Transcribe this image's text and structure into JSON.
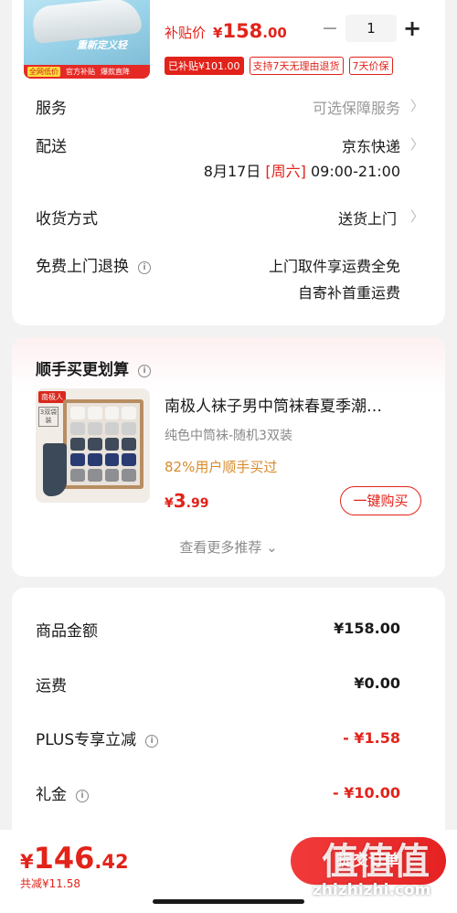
{
  "product": {
    "thumb_slogan": "重新定义轻",
    "thumb_badges": [
      "全网低价",
      "官方补贴",
      "爆款直降"
    ],
    "price_label": "补贴价",
    "currency": "¥",
    "price_main": "158",
    "price_decimal": ".00",
    "quantity": "1",
    "minus_symbol": "−",
    "plus_symbol": "+",
    "tags": [
      "已补贴¥101.00",
      "支持7天无理由退货",
      "7天价保"
    ]
  },
  "service": {
    "label": "服务",
    "value": "可选保障服务"
  },
  "delivery": {
    "label": "配送",
    "carrier": "京东快递",
    "date": "8月17日",
    "weekday": "[周六]",
    "time": "09:00-21:00"
  },
  "receive": {
    "label": "收货方式",
    "value": "送货上门"
  },
  "free_return": {
    "label": "免费上门退换",
    "line1": "上门取件享运费全免",
    "line2": "自寄补首重运费"
  },
  "recommend": {
    "title": "顺手买更划算",
    "image_logo": "南极人",
    "image_badge": "3双袋装",
    "name": "南极人袜子男中筒袜春夏季潮…",
    "spec": "纯色中筒袜-随机3双装",
    "percent": "82%用户顺手买过",
    "price_currency": "¥",
    "price_main": "3",
    "price_decimal": ".99",
    "buy_label": "一键购买",
    "more_label": "查看更多推荐"
  },
  "summary": {
    "items": [
      {
        "label": "商品金额",
        "value": "¥158.00"
      },
      {
        "label": "运费",
        "value": "¥0.00"
      },
      {
        "label": "PLUS专享立减",
        "value": "- ¥1.58"
      },
      {
        "label": "礼金",
        "value": "- ¥10.00"
      }
    ]
  },
  "bottom_bar": {
    "currency": "¥",
    "total_main": "146",
    "total_decimal": ".42",
    "saved": "共减¥11.58",
    "submit_label": "提交订单"
  },
  "watermark": {
    "logo": "值值值",
    "url": "zhizhizhi.com"
  },
  "colors": {
    "accent": "#e2231a",
    "orange": "#d98a2a",
    "page_bg": "#f2f2f2"
  }
}
